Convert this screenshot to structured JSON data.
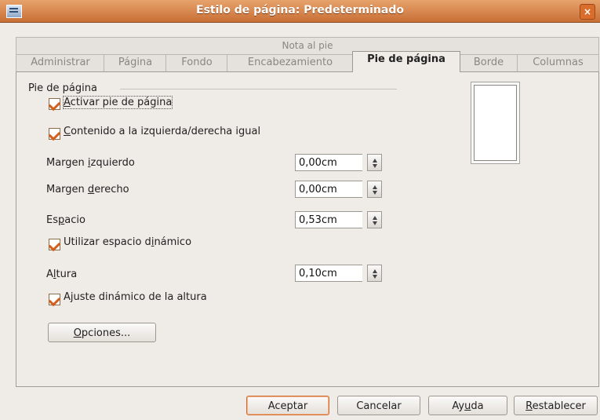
{
  "window": {
    "title": "Estilo de página: Predeterminado",
    "close_label": "×"
  },
  "tabs_row1": {
    "label": "Nota al pie"
  },
  "tabs_row2": [
    "Administrar",
    "Página",
    "Fondo",
    "Encabezamiento",
    "Pie de página",
    "Borde",
    "Columnas"
  ],
  "section": {
    "title": "Pie de página"
  },
  "checks": {
    "activate": {
      "label_u": "A",
      "label_rest": "ctivar pie de página",
      "checked": true
    },
    "same": {
      "label_u": "C",
      "label_rest": "ontenido a la izquierda/derecha igual",
      "checked": true
    },
    "dynamic_space": {
      "label_pre": "Utilizar espacio d",
      "label_u": "i",
      "label_post": "námico",
      "checked": true
    },
    "dynamic_height": {
      "label_pre": "A",
      "label_u": "j",
      "label_post": "uste dinámico de la altura",
      "checked": true
    }
  },
  "fields": {
    "left_margin": {
      "pre": "Margen ",
      "u": "i",
      "post": "zquierdo",
      "value": "0,00cm"
    },
    "right_margin": {
      "pre": "Margen ",
      "u": "d",
      "post": "erecho",
      "value": "0,00cm"
    },
    "spacing": {
      "pre": "Es",
      "u": "p",
      "post": "acio",
      "value": "0,53cm"
    },
    "height": {
      "pre": "A",
      "u": "l",
      "post": "tura",
      "value": "0,10cm"
    }
  },
  "buttons": {
    "options": {
      "u": "O",
      "rest": "pciones..."
    },
    "accept": "Aceptar",
    "cancel": "Cancelar",
    "help": {
      "pre": "Ay",
      "u": "u",
      "post": "da"
    },
    "reset": {
      "u": "R",
      "rest": "establecer"
    }
  },
  "colors": {
    "titlebar": "#c86f35",
    "accent": "#d35f1d"
  }
}
